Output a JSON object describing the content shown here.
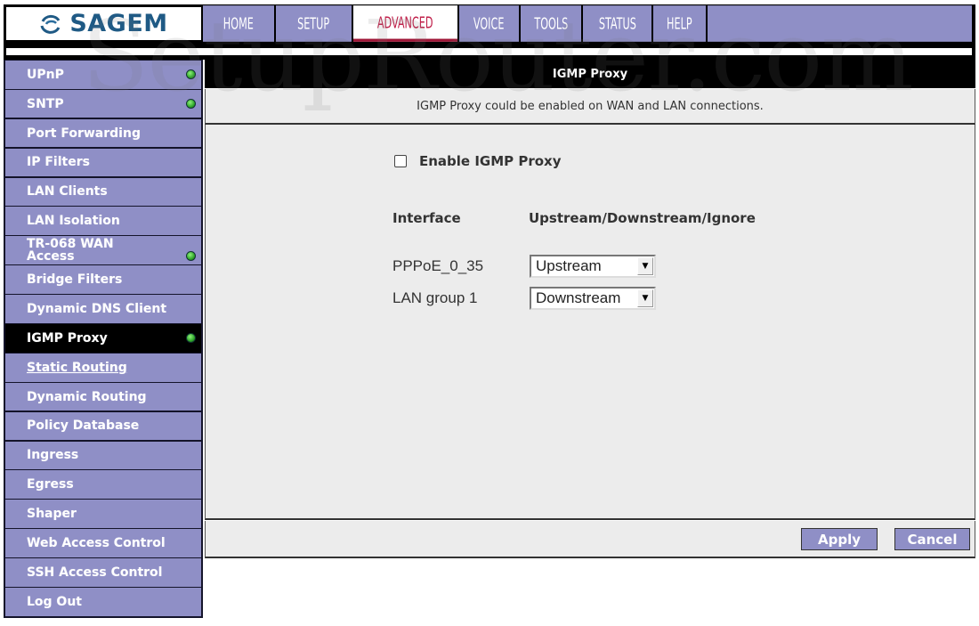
{
  "brand": {
    "name": "SAGEM",
    "logo_icon": "sagem-swirl-logo"
  },
  "topnav": {
    "tabs": [
      {
        "label": "HOME",
        "active": false
      },
      {
        "label": "SETUP",
        "active": false
      },
      {
        "label": "ADVANCED",
        "active": true
      },
      {
        "label": "VOICE",
        "active": false
      },
      {
        "label": "TOOLS",
        "active": false
      },
      {
        "label": "STATUS",
        "active": false
      },
      {
        "label": "HELP",
        "active": false
      }
    ]
  },
  "sidebar": {
    "items": [
      {
        "label": "UPnP",
        "status_dot": true
      },
      {
        "label": "SNTP",
        "status_dot": true
      },
      {
        "label": "Port Forwarding",
        "status_dot": false
      },
      {
        "label": "IP Filters",
        "status_dot": false
      },
      {
        "label": "LAN Clients",
        "status_dot": false
      },
      {
        "label": "LAN Isolation",
        "status_dot": false
      },
      {
        "label": "TR-068 WAN Access",
        "status_dot": true
      },
      {
        "label": "Bridge Filters",
        "status_dot": false
      },
      {
        "label": "Dynamic DNS Client",
        "status_dot": false
      },
      {
        "label": "IGMP Proxy",
        "status_dot": true,
        "active": true
      },
      {
        "label": "Static Routing",
        "status_dot": false,
        "hovered": true
      },
      {
        "label": "Dynamic Routing",
        "status_dot": false
      },
      {
        "label": "Policy Database",
        "status_dot": false
      },
      {
        "label": "Ingress",
        "status_dot": false
      },
      {
        "label": "Egress",
        "status_dot": false
      },
      {
        "label": "Shaper",
        "status_dot": false
      },
      {
        "label": "Web Access Control",
        "status_dot": false
      },
      {
        "label": "SSH Access Control",
        "status_dot": false
      },
      {
        "label": "Log Out",
        "status_dot": false
      }
    ]
  },
  "main": {
    "title": "IGMP Proxy",
    "description": "IGMP Proxy could be enabled on WAN and LAN connections.",
    "enable_checkbox": {
      "label": "Enable IGMP Proxy",
      "checked": false
    },
    "table": {
      "headers": [
        "Interface",
        "Upstream/Downstream/Ignore"
      ],
      "rows": [
        {
          "interface": "PPPoE_0_35",
          "mode": "Upstream"
        },
        {
          "interface": "LAN group 1",
          "mode": "Downstream"
        }
      ]
    },
    "buttons": {
      "apply": "Apply",
      "cancel": "Cancel"
    }
  },
  "watermark": "SetupRouter.com",
  "colors": {
    "nav_purple": "#8f8fc6",
    "active_tab_text": "#c0204a",
    "status_green": "#2fa62a",
    "brand_blue": "#1f5a85"
  }
}
